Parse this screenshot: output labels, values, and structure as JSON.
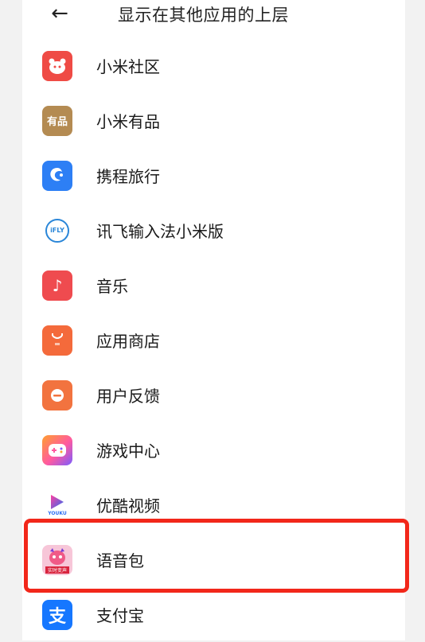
{
  "header": {
    "back_icon": "arrow-left-icon",
    "title": "显示在其他应用的上层"
  },
  "apps": [
    {
      "label": "小米社区",
      "icon": "mi-community-icon",
      "color": "#ef4b45"
    },
    {
      "label": "小米有品",
      "icon": "youpin-icon",
      "color": "#b48b52"
    },
    {
      "label": "携程旅行",
      "icon": "ctrip-icon",
      "color": "#2d7ff5"
    },
    {
      "label": "讯飞输入法小米版",
      "icon": "ifly-icon",
      "color": "#2a86d8"
    },
    {
      "label": "音乐",
      "icon": "music-icon",
      "color": "#ef4b4f"
    },
    {
      "label": "应用商店",
      "icon": "app-store-icon",
      "color": "#f46a3b"
    },
    {
      "label": "用户反馈",
      "icon": "feedback-icon",
      "color": "#f2733f"
    },
    {
      "label": "游戏中心",
      "icon": "game-center-icon",
      "color": "#ff5aa0"
    },
    {
      "label": "优酷视频",
      "icon": "youku-icon",
      "color": "#2b6df3"
    },
    {
      "label": "语音包",
      "icon": "voice-pack-icon",
      "color": "#f05a87"
    },
    {
      "label": "支付宝",
      "icon": "alipay-icon",
      "color": "#1677ff"
    }
  ],
  "icon_texts": {
    "youpin": "有品",
    "ifly": "iFLY",
    "youku": "YOUKU",
    "voice_pack": "实时变声"
  },
  "highlight_color": "#f2271a"
}
